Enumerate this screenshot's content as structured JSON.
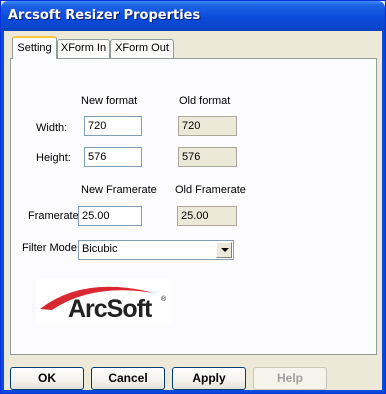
{
  "window": {
    "title": "Arcsoft Resizer Properties"
  },
  "tabs": [
    {
      "label": "Setting",
      "active": true
    },
    {
      "label": "XForm In",
      "active": false
    },
    {
      "label": "XForm Out",
      "active": false
    }
  ],
  "format": {
    "new_header": "New format",
    "old_header": "Old format",
    "width_label": "Width:",
    "height_label": "Height:",
    "width_new": "720",
    "width_old": "720",
    "height_new": "576",
    "height_old": "576"
  },
  "framerate": {
    "new_header": "New Framerate",
    "old_header": "Old Framerate",
    "label": "Framerate:",
    "new_value": "25.00",
    "old_value": "25.00"
  },
  "filter": {
    "label": "Filter Mode:",
    "selected": "Bicubic"
  },
  "logo": {
    "text": "ArcSoft",
    "mark": "®",
    "arc_color": "#d9282f"
  },
  "buttons": {
    "ok": "OK",
    "cancel": "Cancel",
    "apply": "Apply",
    "help": "Help"
  },
  "colors": {
    "titlebar": "#0a4bd9",
    "dialog_bg": "#ece9d8",
    "active_tab_accent": "#ffc73c"
  }
}
